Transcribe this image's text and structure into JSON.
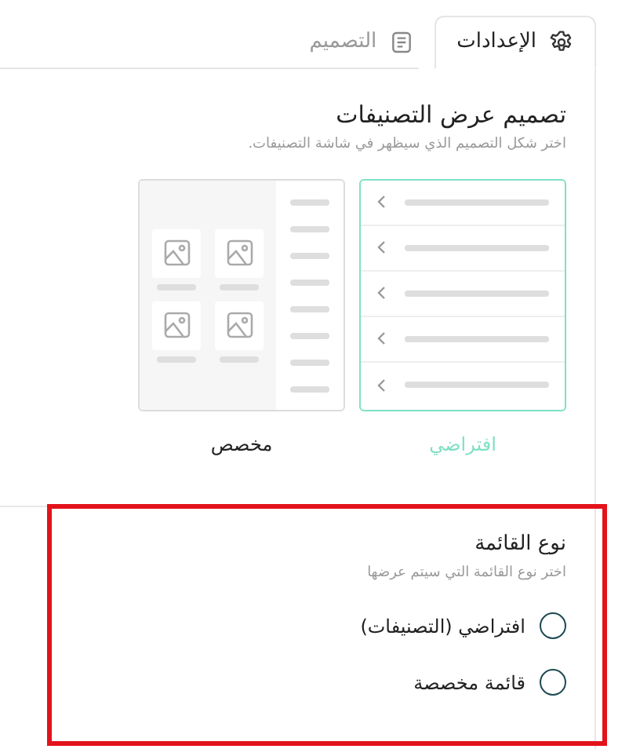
{
  "tabs": [
    {
      "label": "الإعدادات",
      "kind": "gear",
      "selected": true
    },
    {
      "label": "التصميم",
      "kind": "list",
      "selected": false
    }
  ],
  "display_design": {
    "title": "تصميم عرض التصنيفات",
    "subtitle": "اختر شكل التصميم الذي سيظهر في شاشة التصنيفات.",
    "options": [
      {
        "kind": "list",
        "label": "افتراضي",
        "selected": true
      },
      {
        "kind": "grid",
        "label": "مخصص",
        "selected": false
      }
    ]
  },
  "list_type": {
    "title": "نوع القائمة",
    "subtitle": "اختر نوع القائمة التي سيتم عرضها",
    "highlighted": true,
    "options": [
      {
        "label": "افتراضي (التصنيفات)",
        "selected": false
      },
      {
        "label": "قائمة مخصصة",
        "selected": false
      }
    ]
  }
}
